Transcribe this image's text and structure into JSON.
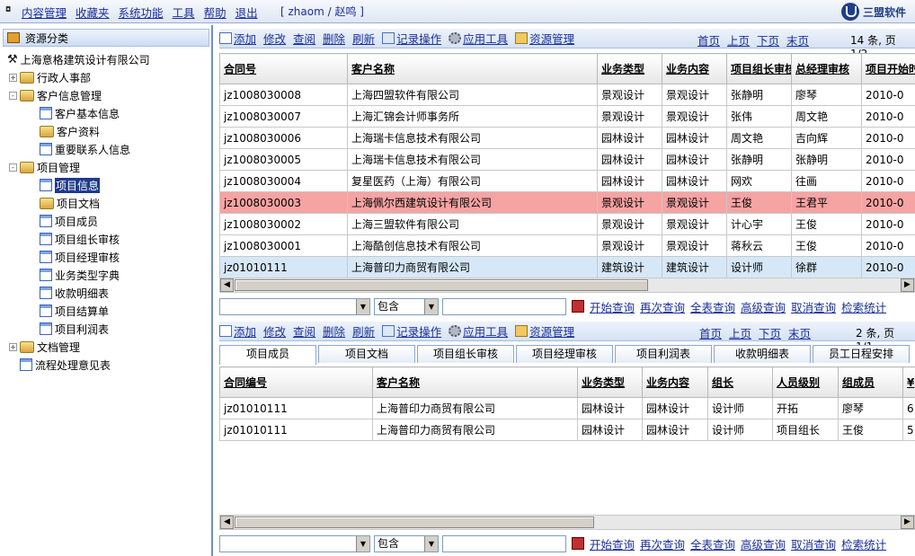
{
  "menu": {
    "items": [
      "内容管理",
      "收藏夹",
      "系统功能",
      "工具",
      "帮助",
      "退出"
    ],
    "user": "[ zhaom / 赵鸣 ]",
    "brand": "三盟软件"
  },
  "sidebar": {
    "title": "资源分类",
    "company": "上海意格建筑设计有限公司",
    "nodes": [
      {
        "label": "行政人事部",
        "type": "folder"
      },
      {
        "label": "客户信息管理",
        "type": "folder"
      },
      {
        "label": "客户基本信息",
        "type": "doc"
      },
      {
        "label": "客户资料",
        "type": "folder"
      },
      {
        "label": "重要联系人信息",
        "type": "doc"
      },
      {
        "label": "项目管理",
        "type": "folder"
      },
      {
        "label": "项目信息",
        "type": "doc"
      },
      {
        "label": "项目文档",
        "type": "folder"
      },
      {
        "label": "项目成员",
        "type": "doc"
      },
      {
        "label": "项目组长审核",
        "type": "doc"
      },
      {
        "label": "项目经理审核",
        "type": "doc"
      },
      {
        "label": "业务类型字典",
        "type": "doc"
      },
      {
        "label": "收款明细表",
        "type": "doc"
      },
      {
        "label": "项目结算单",
        "type": "doc"
      },
      {
        "label": "项目利润表",
        "type": "doc"
      },
      {
        "label": "文档管理",
        "type": "folder"
      },
      {
        "label": "流程处理意见表",
        "type": "doc"
      }
    ]
  },
  "toolbar": {
    "add": "添加",
    "edit": "修改",
    "view": "查阅",
    "delete": "删除",
    "refresh": "刷新",
    "record_ops": "记录操作",
    "app_tools": "应用工具",
    "resource_mgmt": "资源管理"
  },
  "pager": {
    "first": "首页",
    "prev": "上页",
    "next": "下页",
    "last": "末页"
  },
  "grid1": {
    "info": "14 条, 页 1/2",
    "headers": [
      "合同号",
      "客户名称",
      "业务类型",
      "业务内容",
      "项目组长审核",
      "总经理审核",
      "项目开始时"
    ],
    "rows": [
      [
        "jz1008030008",
        "上海四盟软件有限公司",
        "景观设计",
        "景观设计",
        "张静明",
        "廖琴",
        "2010-0"
      ],
      [
        "jz1008030007",
        "上海汇锦会计师事务所",
        "景观设计",
        "景观设计",
        "张伟",
        "周文艳",
        "2010-0"
      ],
      [
        "jz1008030006",
        "上海瑞卡信息技术有限公司",
        "园林设计",
        "园林设计",
        "周文艳",
        "吉向辉",
        "2010-0"
      ],
      [
        "jz1008030005",
        "上海瑞卡信息技术有限公司",
        "园林设计",
        "园林设计",
        "张静明",
        "张静明",
        "2010-0"
      ],
      [
        "jz1008030004",
        "复星医药（上海）有限公司",
        "园林设计",
        "园林设计",
        "网欢",
        "往画",
        "2010-0"
      ],
      [
        "jz1008030003",
        "上海佩尔西建筑设计有限公司",
        "景观设计",
        "景观设计",
        "王俊",
        "王君平",
        "2010-0"
      ],
      [
        "jz1008030002",
        "上海三盟软件有限公司",
        "景观设计",
        "景观设计",
        "计心宇",
        "王俊",
        "2010-0"
      ],
      [
        "jz1008030001",
        "上海酷创信息技术有限公司",
        "景观设计",
        "景观设计",
        "蒋秋云",
        "王俊",
        "2010-0"
      ],
      [
        "jz01010111",
        "上海普印力商贸有限公司",
        "建筑设计",
        "建筑设计",
        "设计师",
        "徐群",
        "2010-0"
      ]
    ]
  },
  "query": {
    "op": "包含",
    "start": "开始查询",
    "again": "再次查询",
    "all": "全表查询",
    "advanced": "高级查询",
    "cancel": "取消查询",
    "stats": "检索统计"
  },
  "grid2": {
    "info": "2 条, 页 1/1",
    "tabs": [
      "项目成员",
      "项目文档",
      "项目组长审核",
      "项目经理审核",
      "项目利润表",
      "收款明细表",
      "员工日程安排"
    ],
    "headers": [
      "合同编号",
      "客户名称",
      "业务类型",
      "业务内容",
      "组长",
      "人员级别",
      "组成员",
      "¥"
    ],
    "rows": [
      [
        "jz01010111",
        "上海普印力商贸有限公司",
        "园林设计",
        "园林设计",
        "设计师",
        "开拓",
        "廖琴",
        "6"
      ],
      [
        "jz01010111",
        "上海普印力商贸有限公司",
        "园林设计",
        "园林设计",
        "设计师",
        "项目组长",
        "王俊",
        "5"
      ]
    ]
  }
}
